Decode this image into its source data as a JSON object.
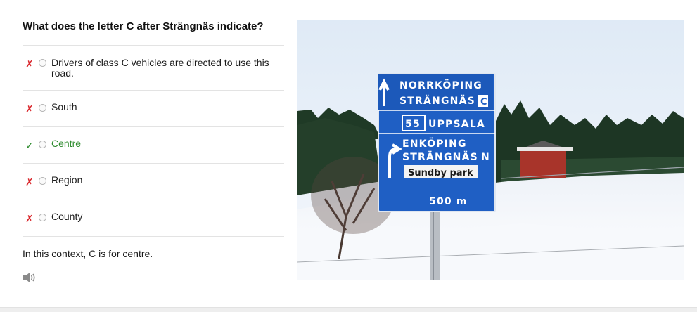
{
  "question": {
    "text": "What does the letter C after Strängnäs indicate?"
  },
  "options": [
    {
      "label": "Drivers of class C vehicles are directed to use this road.",
      "status": "incorrect",
      "mark": "✗"
    },
    {
      "label": "South",
      "status": "incorrect",
      "mark": "✗"
    },
    {
      "label": "Centre",
      "status": "correct",
      "mark": "✓"
    },
    {
      "label": "Region",
      "status": "incorrect",
      "mark": "✗"
    },
    {
      "label": "County",
      "status": "incorrect",
      "mark": "✗"
    }
  ],
  "explanation": "In this context, C is for centre.",
  "audio": {
    "icon": "speaker-icon"
  },
  "sign": {
    "row1_line1": "NORRKÖPING",
    "row1_line2": "STRÄNGNÄS",
    "row1_suffix": "C",
    "route_number": "55",
    "route_destination": "UPPSALA",
    "row3_line1": "ENKÖPING",
    "row3_line2": "STRÄNGNÄS",
    "row3_suffix": "N",
    "local_destination": "Sundby park",
    "distance": "500 m"
  },
  "colors": {
    "correct": "#2c8a2c",
    "incorrect": "#d9262b",
    "sign_blue": "#1f5fc4"
  }
}
